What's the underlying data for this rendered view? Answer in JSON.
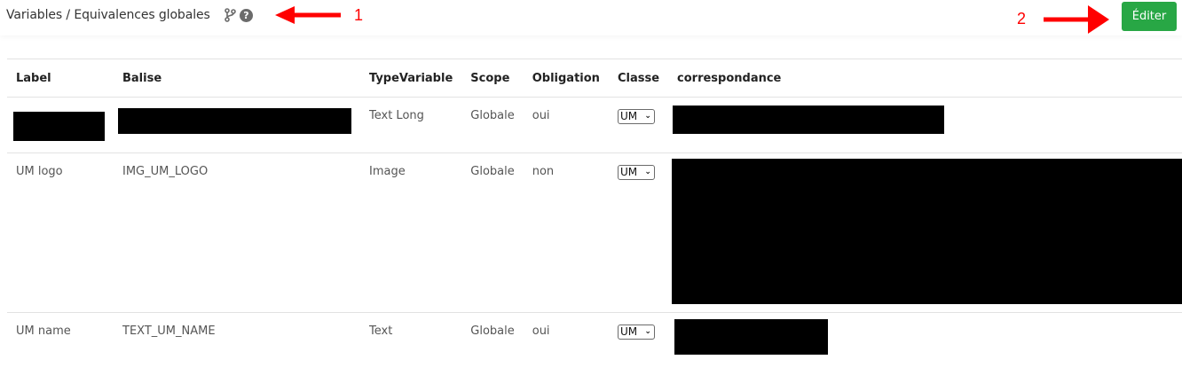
{
  "header": {
    "title": "Variables / Equivalences globales",
    "branch_icon": "branch-icon",
    "help_icon": "help-icon",
    "help_glyph": "?",
    "edit_label": "Éditer",
    "edit_color": "#28a745"
  },
  "annotations": {
    "one": "1",
    "two": "2",
    "color": "#ff0000"
  },
  "table": {
    "columns": [
      "Label",
      "Balise",
      "TypeVariable",
      "Scope",
      "Obligation",
      "Classe",
      "correspondance"
    ],
    "rows": [
      {
        "label": "",
        "balise": "",
        "type": "Text Long",
        "scope": "Globale",
        "obligation": "oui",
        "classe": "UM",
        "correspondance": ""
      },
      {
        "label": "UM logo",
        "balise": "IMG_UM_LOGO",
        "type": "Image",
        "scope": "Globale",
        "obligation": "non",
        "classe": "UM",
        "correspondance": ""
      },
      {
        "label": "UM name",
        "balise": "TEXT_UM_NAME",
        "type": "Text",
        "scope": "Globale",
        "obligation": "oui",
        "classe": "UM",
        "correspondance": ""
      }
    ]
  }
}
